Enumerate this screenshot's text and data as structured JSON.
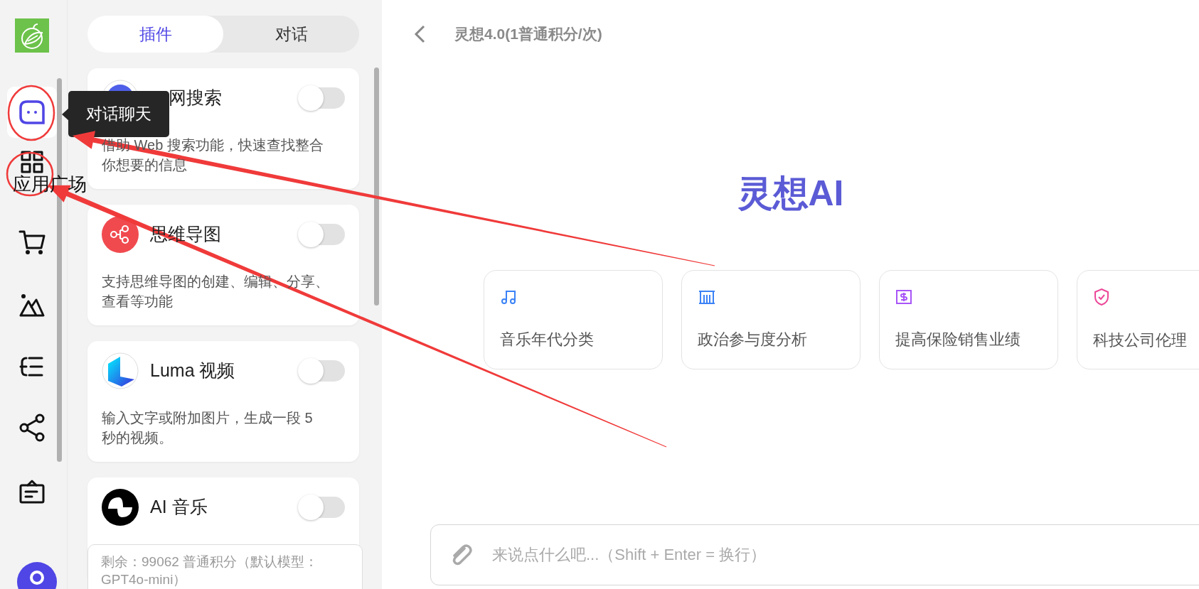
{
  "rail": {
    "items": [
      {
        "kind": "logo"
      },
      {
        "kind": "chat",
        "selected": true
      },
      {
        "kind": "apps",
        "selected": false,
        "label": "应用广场"
      },
      {
        "kind": "cart",
        "selected": false
      },
      {
        "kind": "image",
        "selected": false
      },
      {
        "kind": "list",
        "selected": false
      },
      {
        "kind": "share",
        "selected": false
      },
      {
        "kind": "card",
        "selected": false
      },
      {
        "kind": "avatar"
      }
    ]
  },
  "tooltip": {
    "text": "对话聊天"
  },
  "panel": {
    "tabs": [
      {
        "label": "插件",
        "selected": true
      },
      {
        "label": "对话",
        "selected": false
      }
    ],
    "plugins": [
      {
        "kind": "globe",
        "title": "网搜索",
        "description": "借助 Web 搜索功能，快速查找整合你想要的信息",
        "on": false
      },
      {
        "kind": "mindmap",
        "title": "思维导图",
        "description": "支持思维导图的创建、编辑、分享、查看等功能",
        "on": false
      },
      {
        "kind": "luma",
        "title": "Luma 视频",
        "description": "输入文字或附加图片，生成一段 5 秒的视频。",
        "on": false
      },
      {
        "kind": "music",
        "title": "AI 音乐",
        "on": false
      }
    ],
    "balance": "剩余：99062 普通积分（默认模型：GPT4o-mini）"
  },
  "header": {
    "title": "灵想4.0(1普通积分/次)"
  },
  "brand": "灵想AI",
  "suggestions": [
    {
      "kind": "music",
      "text": "音乐年代分类",
      "color": "#3b82f6"
    },
    {
      "kind": "bank",
      "text": "政治参与度分析",
      "color": "#3b82f6"
    },
    {
      "kind": "dollar",
      "text": "提高保险销售业绩",
      "color": "#a855f7"
    },
    {
      "kind": "shield",
      "text": "科技公司伦理",
      "color": "#ec4899"
    }
  ],
  "input": {
    "placeholder": "来说点什么吧...（Shift + Enter = 换行）"
  }
}
